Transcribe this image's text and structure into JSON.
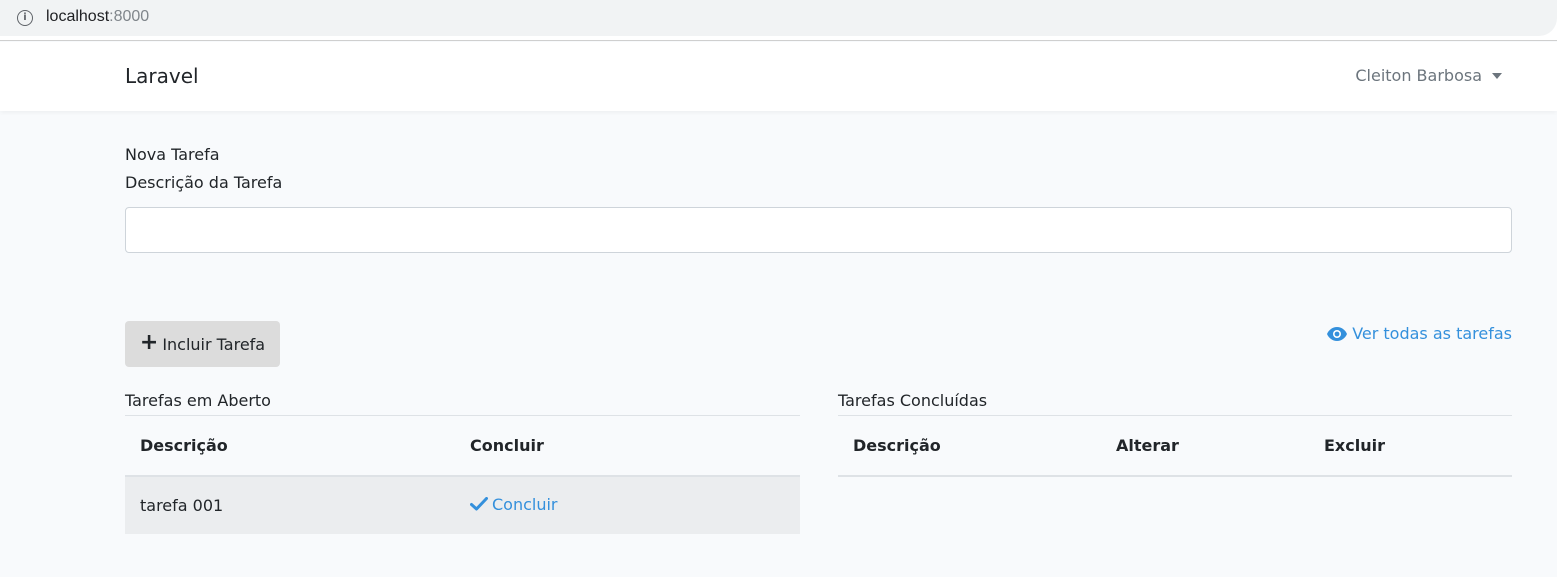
{
  "browser": {
    "url_host": "localhost",
    "url_port": ":8000"
  },
  "navbar": {
    "brand": "Laravel",
    "user_name": "Cleiton Barbosa"
  },
  "form": {
    "title": "Nova Tarefa",
    "description_label": "Descrição da Tarefa",
    "description_value": "",
    "add_button_label": "Incluir Tarefa"
  },
  "view_all_link": "Ver todas as tarefas",
  "open_tasks": {
    "title": "Tarefas em Aberto",
    "columns": [
      "Descrição",
      "Concluir"
    ],
    "rows": [
      {
        "description": "tarefa 001",
        "action": "Concluir"
      }
    ]
  },
  "done_tasks": {
    "title": "Tarefas Concluídas",
    "columns": [
      "Descrição",
      "Alterar",
      "Excluir"
    ],
    "rows": []
  },
  "colors": {
    "accent": "#3490dc",
    "background": "#f8fafc",
    "button_bg": "#dcdcdc",
    "row_bg": "#ebedef"
  },
  "icons": {
    "address_bar": "info-icon",
    "user_menu": "caret-down-icon",
    "add_button": "plus-icon",
    "view_all": "eye-icon",
    "conclude": "check-icon"
  }
}
